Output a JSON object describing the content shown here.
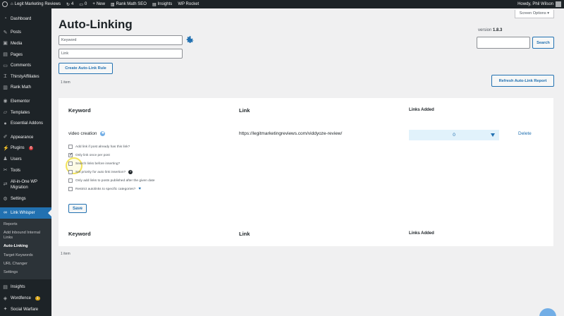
{
  "adminbar": {
    "site_name": "Legit Marketing Reviews",
    "updates_count": "4",
    "comments_count": "0",
    "new_label": "New",
    "rank_math": "Rank Math SEO",
    "insights": "Insights",
    "wp_rocket": "WP Rocket",
    "howdy": "Howdy, Phil Wilson"
  },
  "sidebar": {
    "items": [
      {
        "label": "Dashboard",
        "icon": "dashboard-icon"
      },
      {
        "label": "Posts",
        "icon": "pin-icon"
      },
      {
        "label": "Media",
        "icon": "media-icon"
      },
      {
        "label": "Pages",
        "icon": "pages-icon"
      },
      {
        "label": "Comments",
        "icon": "comment-icon"
      },
      {
        "label": "ThirstyAffiliates",
        "icon": "thirsty-icon"
      },
      {
        "label": "Rank Math",
        "icon": "chart-icon"
      },
      {
        "label": "Elementor",
        "icon": "elementor-icon"
      },
      {
        "label": "Templates",
        "icon": "folder-icon"
      },
      {
        "label": "Essential Addons",
        "icon": "ea-icon"
      },
      {
        "label": "Appearance",
        "icon": "brush-icon"
      },
      {
        "label": "Plugins",
        "icon": "plug-icon",
        "badge": "6"
      },
      {
        "label": "Users",
        "icon": "user-icon"
      },
      {
        "label": "Tools",
        "icon": "wrench-icon"
      },
      {
        "label": "All-in-One WP Migration",
        "icon": "migration-icon"
      },
      {
        "label": "Settings",
        "icon": "settings-icon"
      },
      {
        "label": "Link Whisper",
        "icon": "link-icon"
      }
    ],
    "submenu": [
      {
        "label": "Reports"
      },
      {
        "label": "Add Inbound Internal Links"
      },
      {
        "label": "Auto-Linking"
      },
      {
        "label": "Target Keywords"
      },
      {
        "label": "URL Changer"
      },
      {
        "label": "Settings"
      }
    ],
    "bottom": [
      {
        "label": "Insights",
        "icon": "insights-icon"
      },
      {
        "label": "Wordfence",
        "icon": "shield-icon",
        "badge": "1"
      },
      {
        "label": "Social Warfare",
        "icon": "social-icon"
      }
    ]
  },
  "page": {
    "title": "Auto-Linking",
    "screen_options": "Screen Options",
    "version_label": "version",
    "version_number": "1.8.3",
    "keyword_placeholder": "Keyword",
    "link_placeholder": "Link",
    "create_button": "Create Auto-Link Rule",
    "search_button": "Search",
    "refresh_button": "Refresh Auto-Link Report",
    "item_count_top": "1 item",
    "item_count_bottom": "1 item"
  },
  "table": {
    "col_keyword": "Keyword",
    "col_link": "Link",
    "col_links_added": "Links Added",
    "row": {
      "keyword": "video creation",
      "link": "https://legitmarketingreviews.com/viddyoze-review/",
      "links_added": "0",
      "delete": "Delete"
    },
    "options": [
      {
        "label": "Add link if post already has this link?",
        "checked": false
      },
      {
        "label": "Only link once per post",
        "checked": true
      },
      {
        "label": "Search links before inserting?",
        "checked": false
      },
      {
        "label": "Set priority for auto link insertion?",
        "checked": false
      },
      {
        "label": "Only add links to posts published after the given date",
        "checked": false
      },
      {
        "label": "Restrict autolinks to specific categories?",
        "checked": false
      }
    ],
    "save_button": "Save"
  },
  "colors": {
    "accent": "#2271b1",
    "sidebar_bg": "#1d2327",
    "highlight": "#f2e35b"
  }
}
